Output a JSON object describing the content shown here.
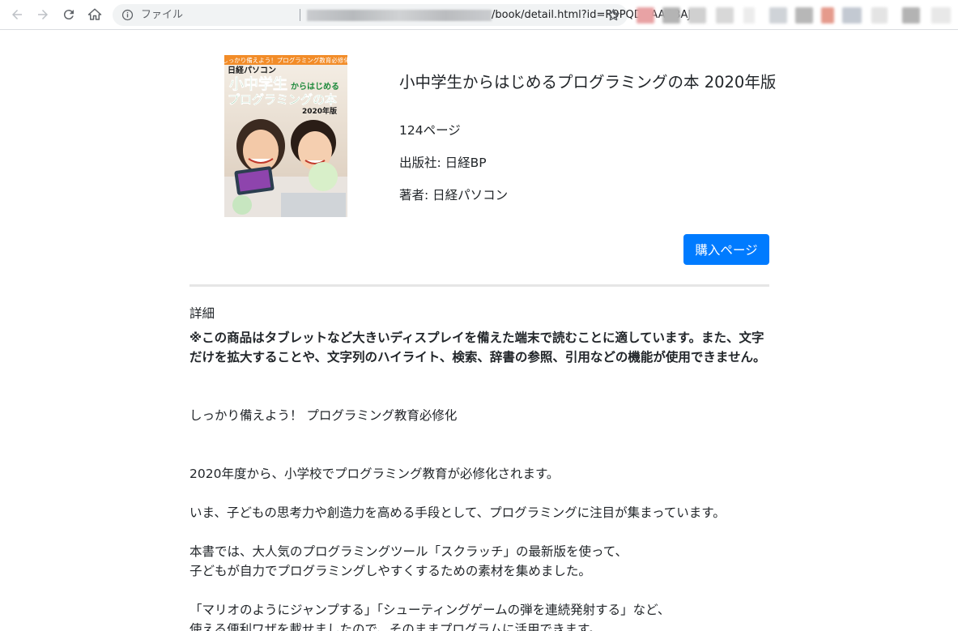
{
  "browser": {
    "scheme_label": "ファイル",
    "url_path": "/book/detail.html?id=R9PQDwAAQBAJ"
  },
  "cover": {
    "banner": "しっかり備えよう！プログラミング教育必修化",
    "brand": "日経パソコン",
    "line1": "小中学生",
    "line1_suffix": "からはじめる",
    "line2": "プログラミングの本",
    "year_badge": "2020年版"
  },
  "book": {
    "title": "小中学生からはじめるプログラミングの本 2020年版",
    "pages": "124ページ",
    "publisher": "出版社: 日経BP",
    "author": "著者: 日経パソコン"
  },
  "actions": {
    "buy_label": "購入ページ"
  },
  "detail": {
    "heading": "詳細",
    "notice": "※この商品はタブレットなど大きいディスプレイを備えた端末で読むことに適しています。また、文字だけを拡大することや、文字列のハイライト、検索、辞書の参照、引用などの機能が使用できません。",
    "tagline": "しっかり備えよう！ プログラミング教育必修化",
    "p1": "2020年度から、小学校でプログラミング教育が必修化されます。",
    "p2": "いま、子どもの思考力や創造力を高める手段として、プログラミングに注目が集まっています。",
    "p3": "本書では、大人気のプログラミングツール「スクラッチ」の最新版を使って、\n子どもが自力でプログラミングしやすくするための素材を集めました。",
    "p4": "「マリオのようにジャンプする」「シューティングゲームの弾を連続発射する」など、\n使える便利ワザを載せましたので、そのままプログラムに活用できます。"
  },
  "colors": {
    "primary": "#007bff",
    "divider": "#e6e6e6",
    "text": "#212529"
  }
}
